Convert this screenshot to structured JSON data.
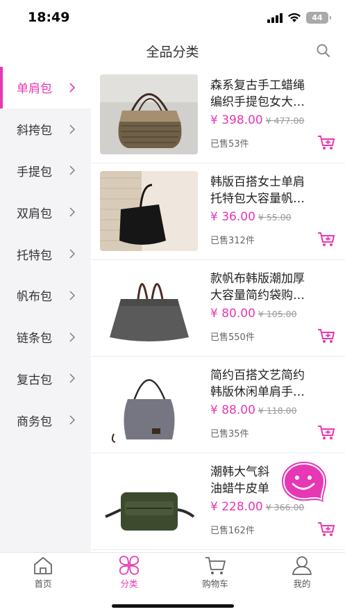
{
  "status_bar": {
    "time": "18:49",
    "battery": "44"
  },
  "header": {
    "title": "全品分类"
  },
  "sidebar": {
    "items": [
      {
        "label": "单肩包",
        "active": true
      },
      {
        "label": "斜挎包"
      },
      {
        "label": "手提包"
      },
      {
        "label": "双肩包"
      },
      {
        "label": "托特包"
      },
      {
        "label": "帆布包"
      },
      {
        "label": "链条包"
      },
      {
        "label": "复古包"
      },
      {
        "label": "商务包"
      }
    ]
  },
  "products": [
    {
      "line1": "森系复古手工蜡绳",
      "line2": "编织手提包女大…",
      "price": "¥ 398.00",
      "original": "¥ 477.00",
      "sold": "已售53件"
    },
    {
      "line1": "韩版百搭女士单肩",
      "line2": "托特包大容量帆…",
      "price": "¥ 36.00",
      "original": "¥ 55.00",
      "sold": "已售312件"
    },
    {
      "line1": "款帆布韩版潮加厚",
      "line2": "大容量简约袋购…",
      "price": "¥ 80.00",
      "original": "¥ 105.00",
      "sold": "已售550件"
    },
    {
      "line1": "简约百搭文艺简约",
      "line2": "韩版休闲单肩手…",
      "price": "¥ 88.00",
      "original": "¥ 118.00",
      "sold": "已售35件"
    },
    {
      "line1": "潮韩大气斜",
      "line2": "油蜡牛皮单",
      "price": "¥ 228.00",
      "original": "¥ 366.00",
      "sold": "已售162件"
    }
  ],
  "tabs": [
    {
      "label": "首页"
    },
    {
      "label": "分类",
      "active": true
    },
    {
      "label": "购物车"
    },
    {
      "label": "我的"
    }
  ],
  "colors": {
    "accent": "#e637b5",
    "sidebar_bg": "#f4f4f6"
  }
}
